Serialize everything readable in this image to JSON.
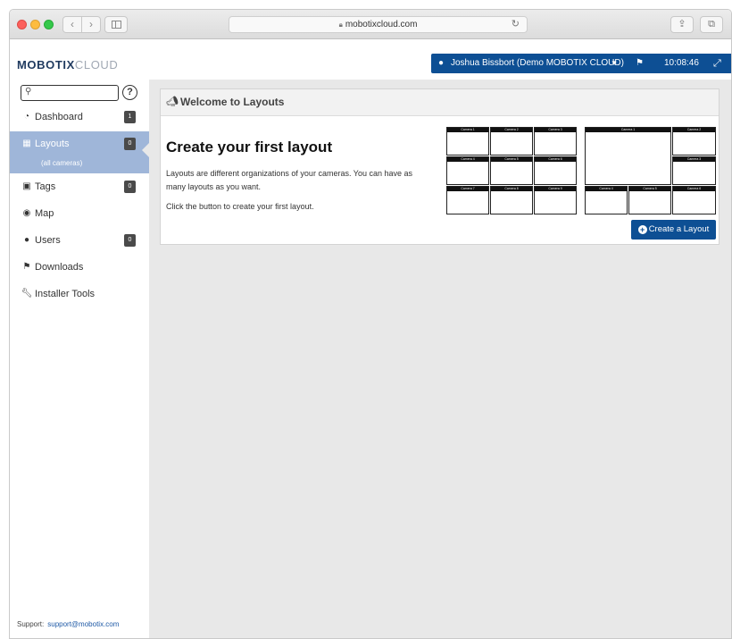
{
  "browser": {
    "url": "mobotixcloud.com",
    "back_glyph": "‹",
    "forward_glyph": "›",
    "reload_glyph": "↻",
    "share_glyph": "⇪",
    "tabs_glyph": "⧉"
  },
  "app": {
    "logo_part1": "MOBOTIX",
    "logo_part2": "CLOUD",
    "user_name": "Joshua Bissbort (Demo MOBOTIX CLOUD)",
    "clock": "10:08:46",
    "brand_color": "#0d4f94"
  },
  "sidebar": {
    "search_placeholder": "",
    "help_label": "?",
    "items": [
      {
        "label": "Dashboard",
        "icon": "dashboard-icon",
        "badge": "1"
      },
      {
        "label": "Layouts",
        "icon": "layouts-icon",
        "badge": "0",
        "sub": "(all cameras)",
        "active": true
      },
      {
        "label": "Tags",
        "icon": "camera-icon",
        "badge": "0"
      },
      {
        "label": "Map",
        "icon": "globe-icon"
      },
      {
        "label": "Users",
        "icon": "users-icon",
        "badge": "0"
      },
      {
        "label": "Downloads",
        "icon": "flag-icon"
      },
      {
        "label": "Installer Tools",
        "icon": "wrench-icon"
      }
    ],
    "support_label": "Support:",
    "support_email": "support@mobotix.com"
  },
  "main": {
    "panel_title": "Welcome to Layouts",
    "heading": "Create your first layout",
    "description": "Layouts are different organizations of your cameras. You can have as many layouts as you want.",
    "instruction": "Click the button to create your first layout.",
    "create_button": "Create a Layout",
    "thumb1_cameras": [
      "Camera 1",
      "Camera 2",
      "Camera 3",
      "Camera 4",
      "Camera 5",
      "Camera 6",
      "Camera 7",
      "Camera 8",
      "Camera 9"
    ],
    "thumb2_cameras": [
      "Camera 1",
      "Camera 2",
      "Camera 3",
      "Camera 4",
      "Camera 5",
      "Camera 6"
    ]
  }
}
